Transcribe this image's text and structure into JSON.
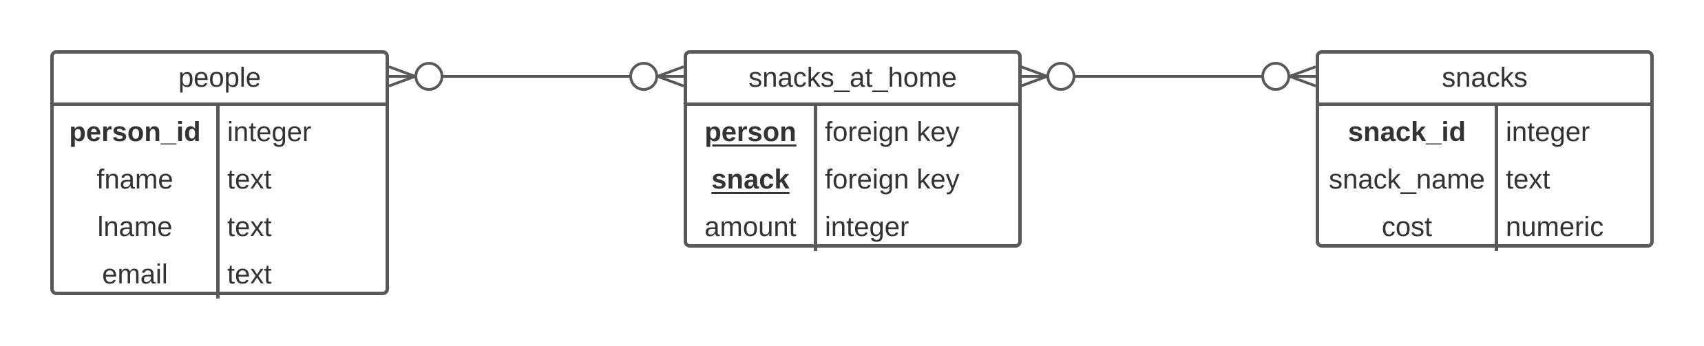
{
  "colors": {
    "border": "#595959",
    "text": "#333333",
    "background": "#ffffff"
  },
  "entities": {
    "people": {
      "title": "people",
      "rows": [
        {
          "name": "person_id",
          "type": "integer",
          "key": "primary"
        },
        {
          "name": "fname",
          "type": "text",
          "key": "none"
        },
        {
          "name": "lname",
          "type": "text",
          "key": "none"
        },
        {
          "name": "email",
          "type": "text",
          "key": "none"
        }
      ]
    },
    "snacks_at_home": {
      "title": "snacks_at_home",
      "rows": [
        {
          "name": "person",
          "type": "foreign key",
          "key": "foreign"
        },
        {
          "name": "snack",
          "type": "foreign key",
          "key": "foreign"
        },
        {
          "name": "amount",
          "type": "integer",
          "key": "none"
        }
      ]
    },
    "snacks": {
      "title": "snacks",
      "rows": [
        {
          "name": "snack_id",
          "type": "integer",
          "key": "primary"
        },
        {
          "name": "snack_name",
          "type": "text",
          "key": "none"
        },
        {
          "name": "cost",
          "type": "numeric",
          "key": "none"
        }
      ]
    }
  },
  "relationships": [
    {
      "from": "people",
      "to": "snacks_at_home",
      "from_cardinality": "zero-or-many",
      "to_cardinality": "zero-or-many"
    },
    {
      "from": "snacks_at_home",
      "to": "snacks",
      "from_cardinality": "zero-or-many",
      "to_cardinality": "zero-or-many"
    }
  ]
}
